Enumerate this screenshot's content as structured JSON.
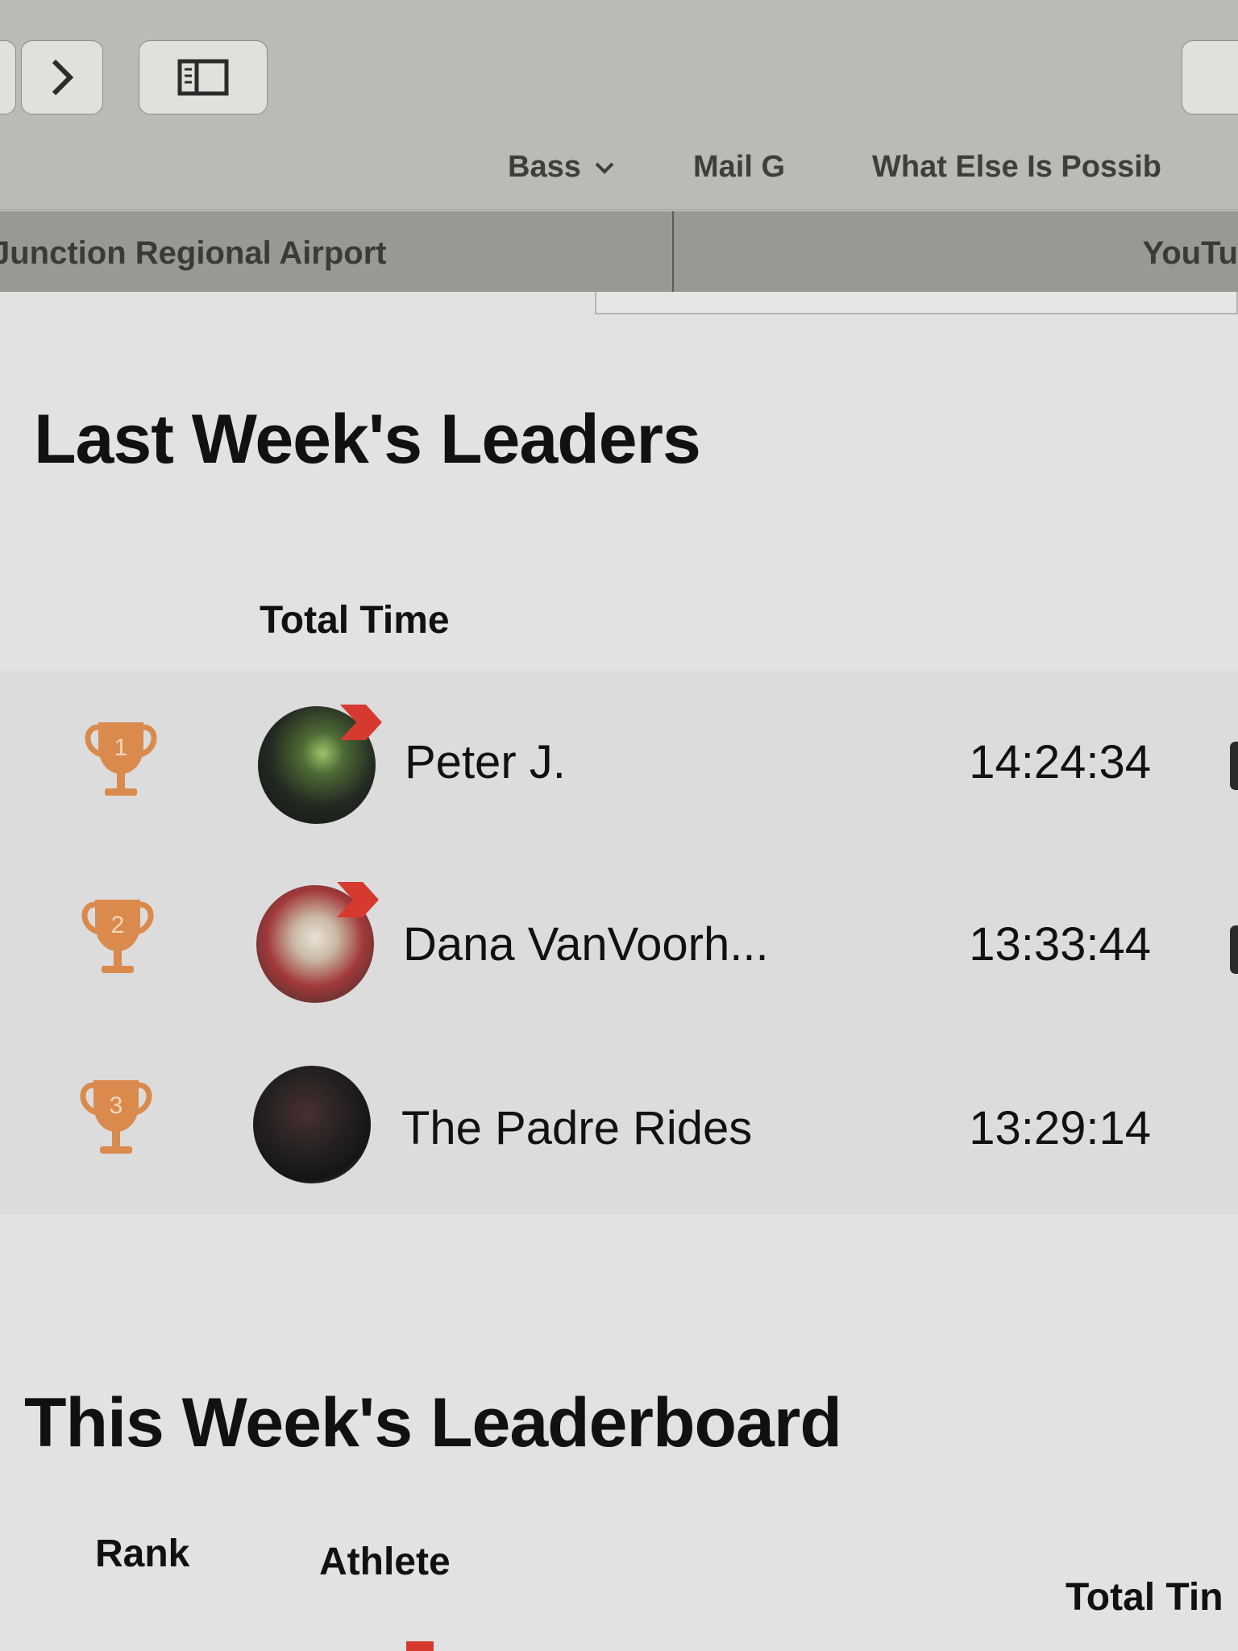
{
  "bookmarks": {
    "item1": "Bass",
    "item2": "Mail G",
    "item3": "What Else Is Possib"
  },
  "tabs": [
    {
      "label": "Junction Regional Airport"
    },
    {
      "label": "YouTu"
    }
  ],
  "last_week": {
    "title": "Last Week's Leaders",
    "column_header": "Total Time",
    "rows": [
      {
        "rank": "1",
        "name": "Peter J.",
        "time": "14:24:34"
      },
      {
        "rank": "2",
        "name": "Dana VanVoorh...",
        "time": "13:33:44"
      },
      {
        "rank": "3",
        "name": "The Padre Rides",
        "time": "13:29:14"
      }
    ]
  },
  "this_week": {
    "title": "This Week's Leaderboard",
    "headers": {
      "rank": "Rank",
      "athlete": "Athlete",
      "total_time": "Total Tin"
    }
  },
  "colors": {
    "trophy": "#d98a4c",
    "badge": "#d63a2f"
  },
  "icons": {
    "back": "chevron-left-icon",
    "forward": "chevron-right-icon",
    "sidebar": "sidebar-icon",
    "dropdown": "chevron-down-icon",
    "trophy": "trophy-icon"
  }
}
